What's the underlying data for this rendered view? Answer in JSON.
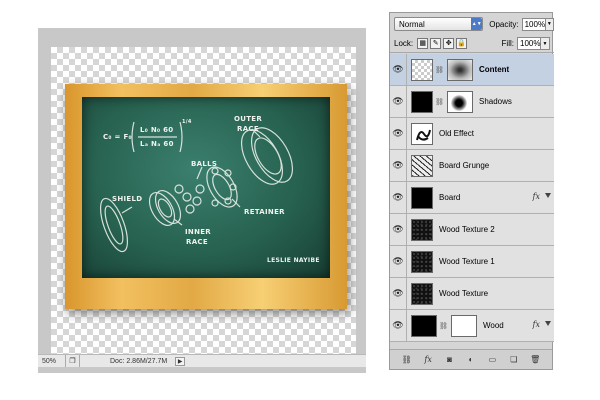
{
  "status": {
    "zoom": "50%",
    "doc_size": "Doc: 2.86M/27.7M"
  },
  "board": {
    "formula_lhs": "C₀ = F₀",
    "formula_num": "L₀ N₀ 60",
    "formula_den": "Lₐ Nₐ 60",
    "formula_exp": "1/4",
    "labels": {
      "outer_race": "OUTER",
      "outer_race_2": "RACE",
      "balls": "BALLS",
      "shield": "SHIELD",
      "retainer": "RETAINER",
      "inner_race": "INNER",
      "inner_race_2": "RACE",
      "signature": "LESLIE NAYIBE"
    }
  },
  "layers_panel": {
    "blend_mode": "Normal",
    "opacity_label": "Opacity:",
    "opacity_value": "100%",
    "lock_label": "Lock:",
    "fill_label": "Fill:",
    "fill_value": "100%",
    "layers": [
      {
        "name": "Content",
        "selected": true
      },
      {
        "name": "Shadows",
        "selected": false
      },
      {
        "name": "Old Effect",
        "selected": false
      },
      {
        "name": "Board Grunge",
        "selected": false
      },
      {
        "name": "Board",
        "selected": false,
        "fx": "fx"
      },
      {
        "name": "Wood Texture 2",
        "selected": false
      },
      {
        "name": "Wood Texture 1",
        "selected": false
      },
      {
        "name": "Wood Texture",
        "selected": false
      },
      {
        "name": "Wood",
        "selected": false,
        "fx": "fx"
      }
    ]
  },
  "icons": {
    "visibility": "eye-icon",
    "link": "chain-link-icon",
    "lock_transparent": "lock-transparent-pixels-icon",
    "lock_image": "lock-image-pixels-icon",
    "lock_position": "lock-position-icon",
    "lock_all": "lock-all-icon",
    "bottom": [
      "link-layers-icon",
      "fx-icon",
      "add-mask-icon",
      "adjustment-layer-icon",
      "new-group-icon",
      "new-layer-icon",
      "trash-icon"
    ]
  },
  "colors": {
    "board_green": "#27614f",
    "frame_wood": "#e2a945",
    "selected_layer": "#c3d1e3",
    "panel_bg": "#d5d5d5"
  }
}
